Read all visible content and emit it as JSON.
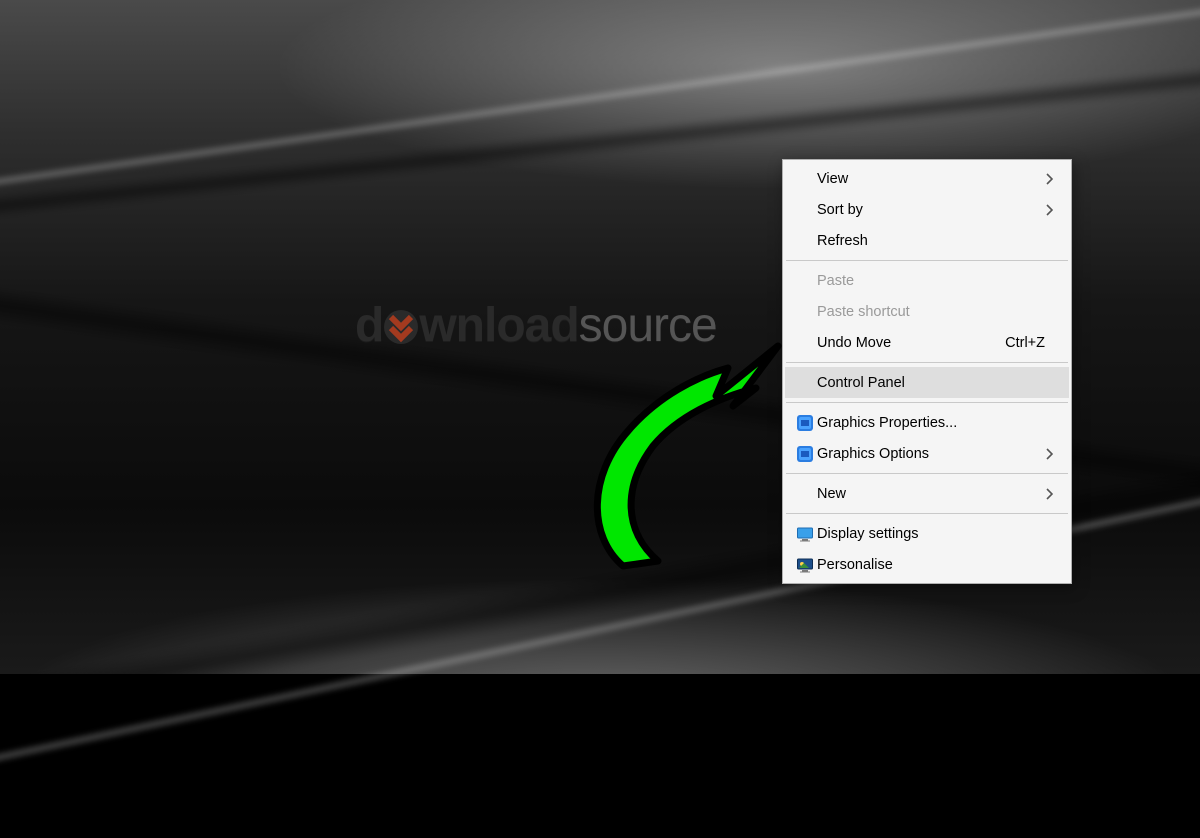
{
  "wallpaper_logo": {
    "part1": "d",
    "o_with_chevron": "o",
    "part2": "wnload",
    "part3": "source",
    "chevron_color": "#a33a1f"
  },
  "context_menu": {
    "groups": [
      [
        {
          "id": "view",
          "label": "View",
          "submenu": true,
          "disabled": false,
          "shortcut": "",
          "icon": null
        },
        {
          "id": "sortby",
          "label": "Sort by",
          "submenu": true,
          "disabled": false,
          "shortcut": "",
          "icon": null
        },
        {
          "id": "refresh",
          "label": "Refresh",
          "submenu": false,
          "disabled": false,
          "shortcut": "",
          "icon": null
        }
      ],
      [
        {
          "id": "paste",
          "label": "Paste",
          "submenu": false,
          "disabled": true,
          "shortcut": "",
          "icon": null
        },
        {
          "id": "pasteshortcut",
          "label": "Paste shortcut",
          "submenu": false,
          "disabled": true,
          "shortcut": "",
          "icon": null
        },
        {
          "id": "undomove",
          "label": "Undo Move",
          "submenu": false,
          "disabled": false,
          "shortcut": "Ctrl+Z",
          "icon": null
        }
      ],
      [
        {
          "id": "controlpanel",
          "label": "Control Panel",
          "submenu": false,
          "disabled": false,
          "shortcut": "",
          "icon": null,
          "hover": true
        }
      ],
      [
        {
          "id": "gfxprops",
          "label": "Graphics Properties...",
          "submenu": false,
          "disabled": false,
          "shortcut": "",
          "icon": "intel"
        },
        {
          "id": "gfxoptions",
          "label": "Graphics Options",
          "submenu": true,
          "disabled": false,
          "shortcut": "",
          "icon": "intel"
        }
      ],
      [
        {
          "id": "new",
          "label": "New",
          "submenu": true,
          "disabled": false,
          "shortcut": "",
          "icon": null
        }
      ],
      [
        {
          "id": "display",
          "label": "Display settings",
          "submenu": false,
          "disabled": false,
          "shortcut": "",
          "icon": "display"
        },
        {
          "id": "personalise",
          "label": "Personalise",
          "submenu": false,
          "disabled": false,
          "shortcut": "",
          "icon": "personalise"
        }
      ]
    ]
  },
  "annotation": {
    "arrow_color": "#00e700",
    "arrow_stroke": "#000000"
  }
}
